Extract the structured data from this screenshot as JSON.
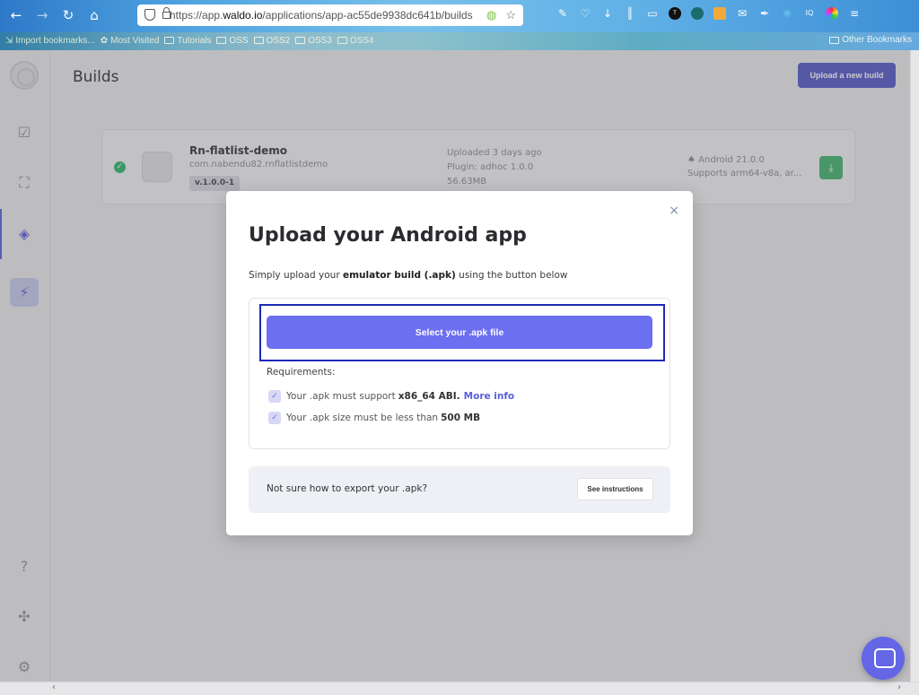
{
  "browser": {
    "url_prefix": "https://app.",
    "url_domain": "waldo.io",
    "url_path": "/applications/app-ac55de9938dc641b/builds",
    "bookmarks": [
      "Import bookmarks...",
      "Most Visited",
      "Tutorials",
      "OSS",
      "OSS2",
      "OSS3",
      "OSS4"
    ],
    "other_bookmarks": "Other Bookmarks"
  },
  "page": {
    "title": "Builds",
    "upload_button": "Upload a new build"
  },
  "build": {
    "name": "Rn-flatlist-demo",
    "package": "com.nabendu82.rnflatlistdemo",
    "version": "v.1.0.0-1",
    "uploaded": "Uploaded 3 days ago",
    "plugin": "Plugin: adhoc 1.0.0",
    "size": "56.63MB",
    "platform": "Android 21.0.0",
    "supports": "Supports arm64-v8a, ar..."
  },
  "modal": {
    "title": "Upload your Android app",
    "sub_prefix": "Simply upload your ",
    "sub_bold": "emulator build (.apk)",
    "sub_suffix": " using the button below",
    "select_button": "Select your .apk file",
    "requirements_label": "Requirements:",
    "req1_text": "Your .apk must support",
    "req1_bold": "x86_64 ABI.",
    "req1_link": "More info",
    "req2_text": "Your .apk size must be less than",
    "req2_bold": "500 MB",
    "help_text": "Not sure how to export your .apk?",
    "help_button": "See instructions",
    "close": "×"
  },
  "colors": {
    "accent": "#6b6ff0",
    "success": "#2eb56a",
    "highlight": "#1d2ab6"
  }
}
